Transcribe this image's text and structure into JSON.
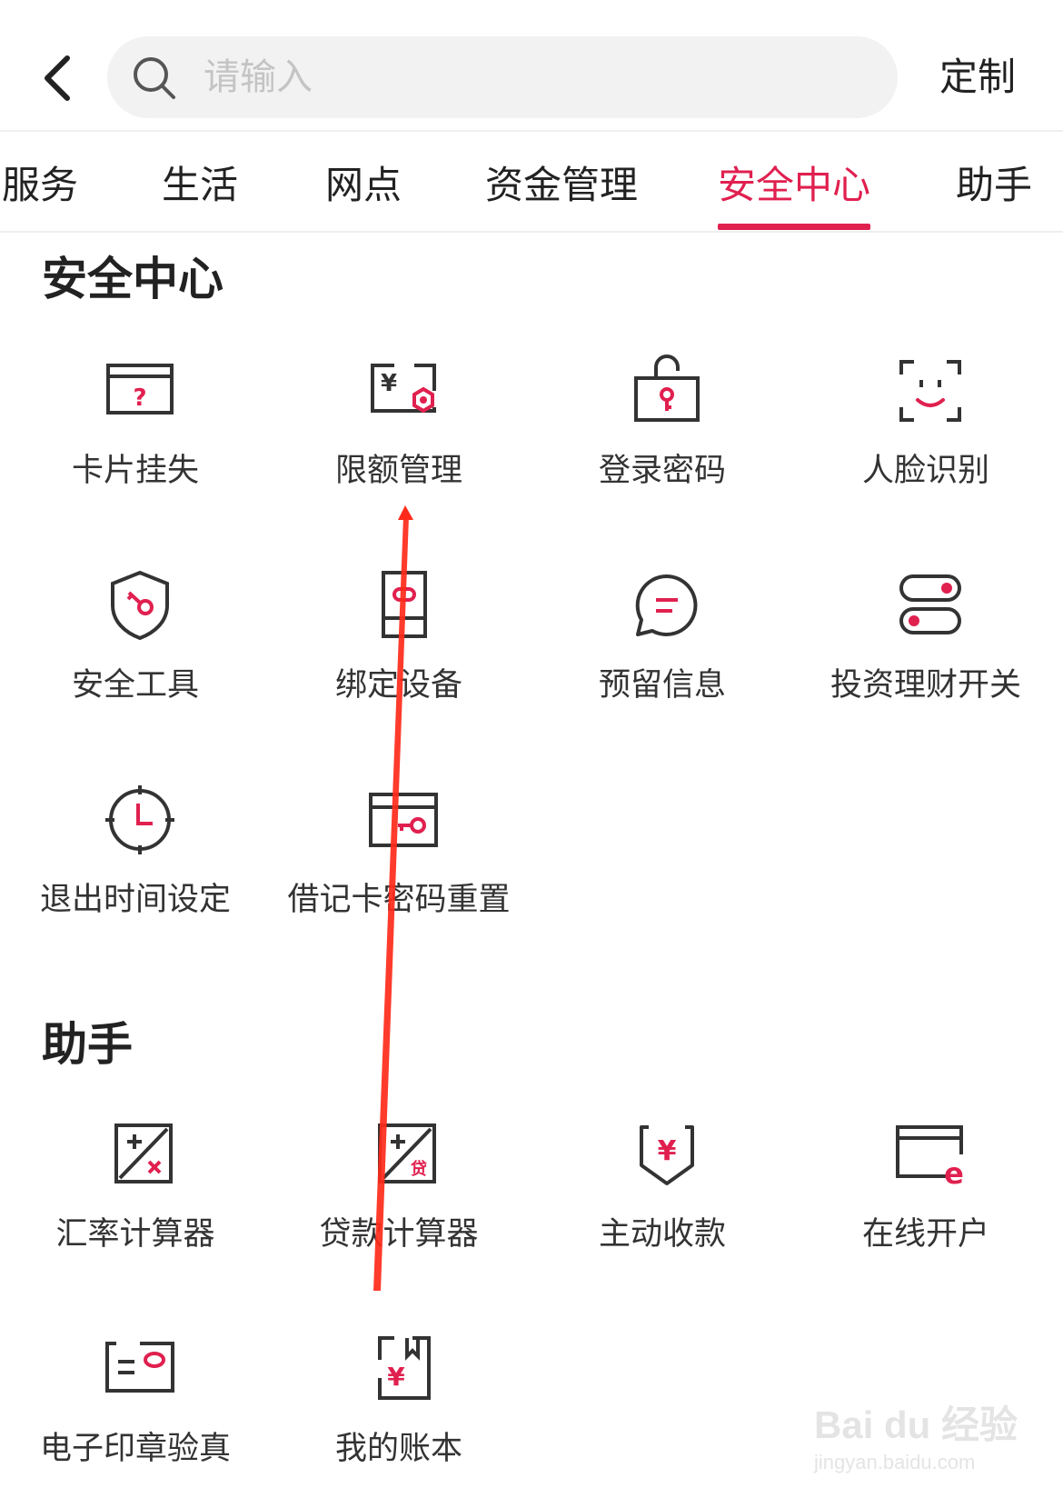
{
  "header": {
    "back_icon": "chevron-left-icon",
    "search": {
      "placeholder": "请输入",
      "value": "",
      "icon": "search-icon"
    },
    "custom_label": "定制"
  },
  "tabs": [
    {
      "label": "服务",
      "active": false
    },
    {
      "label": "生活",
      "active": false
    },
    {
      "label": "网点",
      "active": false
    },
    {
      "label": "资金管理",
      "active": false
    },
    {
      "label": "安全中心",
      "active": true
    },
    {
      "label": "助手",
      "active": false
    }
  ],
  "colors": {
    "accent": "#e0204f",
    "icon_stroke": "#333333",
    "text": "#333333",
    "annotation_arrow": "#ff2a1a"
  },
  "security": {
    "title": "安全中心",
    "items": [
      {
        "label": "卡片挂失",
        "icon": "card-question-icon"
      },
      {
        "label": "限额管理",
        "icon": "limit-settings-icon"
      },
      {
        "label": "登录密码",
        "icon": "lock-key-icon"
      },
      {
        "label": "人脸识别",
        "icon": "face-scan-icon"
      },
      {
        "label": "安全工具",
        "icon": "shield-key-icon"
      },
      {
        "label": "绑定设备",
        "icon": "device-link-icon"
      },
      {
        "label": "预留信息",
        "icon": "message-icon"
      },
      {
        "label": "投资理财开关",
        "icon": "toggle-switch-icon"
      },
      {
        "label": "退出时间设定",
        "icon": "clock-icon"
      },
      {
        "label": "借记卡密码重置",
        "icon": "card-key-icon"
      }
    ]
  },
  "assistant": {
    "title": "助手",
    "items": [
      {
        "label": "汇率计算器",
        "icon": "exchange-calculator-icon"
      },
      {
        "label": "贷款计算器",
        "icon": "loan-calculator-icon"
      },
      {
        "label": "主动收款",
        "icon": "receive-payment-icon"
      },
      {
        "label": "在线开户",
        "icon": "online-account-icon"
      },
      {
        "label": "电子印章验真",
        "icon": "seal-verify-icon"
      },
      {
        "label": "我的账本",
        "icon": "ledger-book-icon"
      }
    ]
  },
  "watermark": {
    "line1": "Bai du 经验",
    "line2": "jingyan.baidu.com"
  }
}
